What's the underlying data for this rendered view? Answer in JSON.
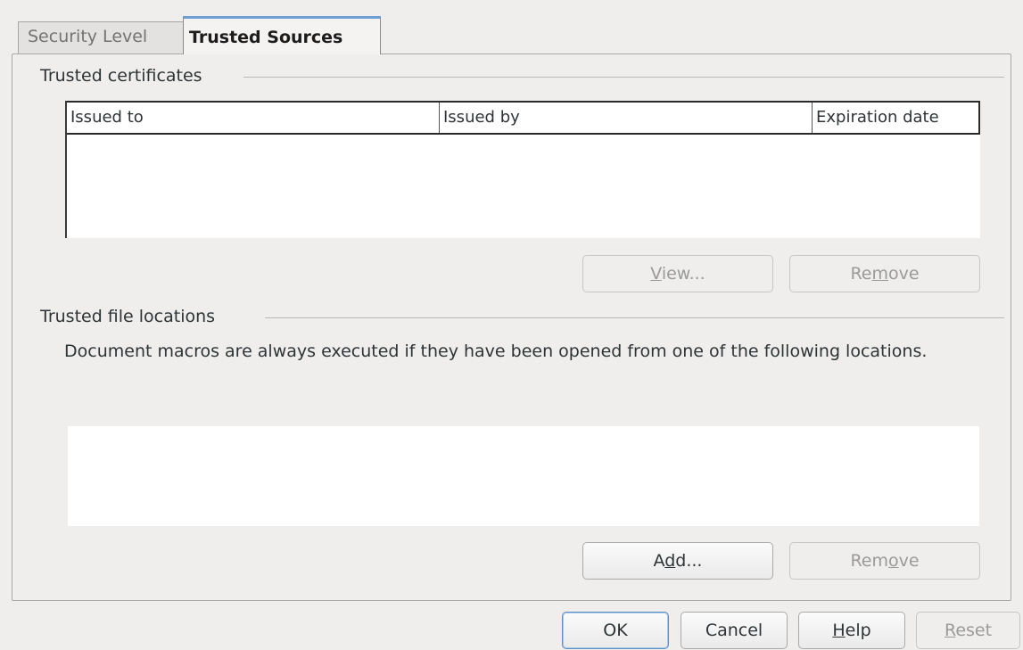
{
  "tabs": {
    "security_level": "Security Level",
    "trusted_sources": "Trusted Sources"
  },
  "certificates": {
    "title": "Trusted certificates",
    "columns": [
      "Issued to",
      "Issued by",
      "Expiration date"
    ],
    "rows": [],
    "view_button": {
      "pre": "",
      "key": "V",
      "post": "iew..."
    },
    "remove_button": {
      "pre": "Re",
      "key": "m",
      "post": "ove"
    }
  },
  "locations": {
    "title": "Trusted file locations",
    "description": "Document macros are always executed if they have been opened from one of the following locations.",
    "items": [],
    "add_button": {
      "pre": "A",
      "key": "d",
      "post": "d..."
    },
    "remove_button": {
      "pre": "Rem",
      "key": "o",
      "post": "ve"
    }
  },
  "footer": {
    "ok": "OK",
    "cancel": "Cancel",
    "help": {
      "pre": "",
      "key": "H",
      "post": "elp"
    },
    "reset": {
      "pre": "",
      "key": "R",
      "post": "eset"
    }
  }
}
